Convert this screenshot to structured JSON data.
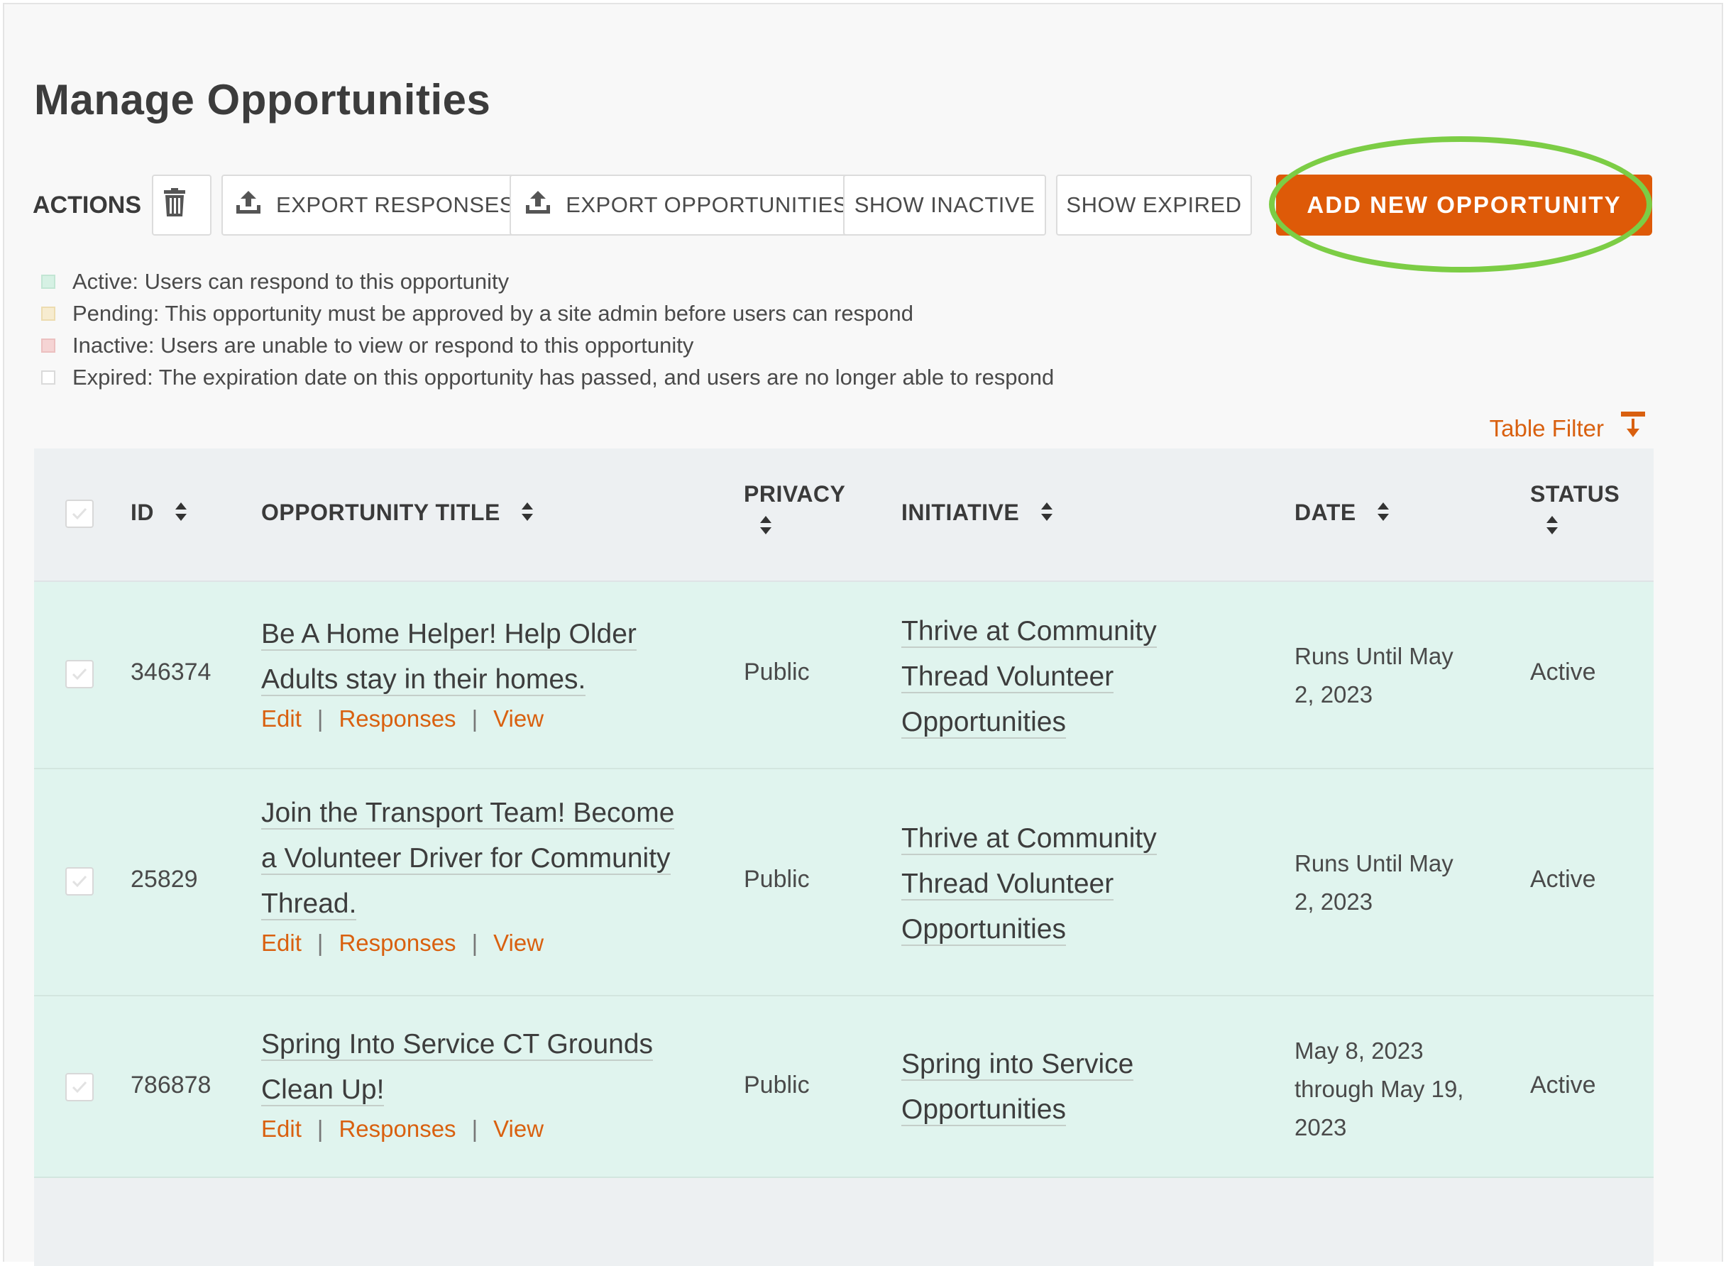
{
  "page": {
    "title": "Manage Opportunities"
  },
  "actions": {
    "label": "ACTIONS",
    "export_responses": "EXPORT RESPONSES",
    "export_opportunities": "EXPORT OPPORTUNITIES",
    "show_inactive": "SHOW INACTIVE",
    "show_expired": "SHOW EXPIRED",
    "add_new": "ADD NEW OPPORTUNITY"
  },
  "legend": {
    "active": "Active: Users can respond to this opportunity",
    "pending": "Pending: This opportunity must be approved by a site admin before users can respond",
    "inactive": "Inactive: Users are unable to view or respond to this opportunity",
    "expired": "Expired: The expiration date on this opportunity has passed, and users are no longer able to respond"
  },
  "table_filter": "Table Filter",
  "table": {
    "headers": {
      "id": "ID",
      "title": "OPPORTUNITY TITLE",
      "privacy": "PRIVACY",
      "initiative": "INITIATIVE",
      "date": "DATE",
      "status": "STATUS"
    },
    "row_actions": {
      "edit": "Edit",
      "responses": "Responses",
      "view": "View",
      "sep": "|"
    },
    "rows": [
      {
        "id": "346374",
        "title_lines": [
          "Be A Home Helper! Help Older",
          "Adults stay in their homes."
        ],
        "privacy": "Public",
        "initiative_lines": [
          "Thrive at Community",
          "Thread Volunteer",
          "Opportunities"
        ],
        "date_lines": [
          "Runs Until May",
          "2, 2023"
        ],
        "status": "Active"
      },
      {
        "id": "25829",
        "title_lines": [
          "Join the Transport Team! Become",
          "a Volunteer Driver for Community",
          "Thread."
        ],
        "privacy": "Public",
        "initiative_lines": [
          "Thrive at Community",
          "Thread Volunteer",
          "Opportunities"
        ],
        "date_lines": [
          "Runs Until May",
          "2, 2023"
        ],
        "status": "Active"
      },
      {
        "id": "786878",
        "title_lines": [
          "Spring Into Service CT Grounds",
          "Clean Up!"
        ],
        "privacy": "Public",
        "initiative_lines": [
          "Spring into Service",
          "Opportunities"
        ],
        "date_lines": [
          "May 8, 2023",
          "through May 19,",
          "2023"
        ],
        "status": "Active"
      }
    ]
  },
  "colors": {
    "accent": "#de5a08",
    "link": "#d9600f",
    "highlight": "#7ccd45",
    "row_active": "#e0f4ee"
  }
}
